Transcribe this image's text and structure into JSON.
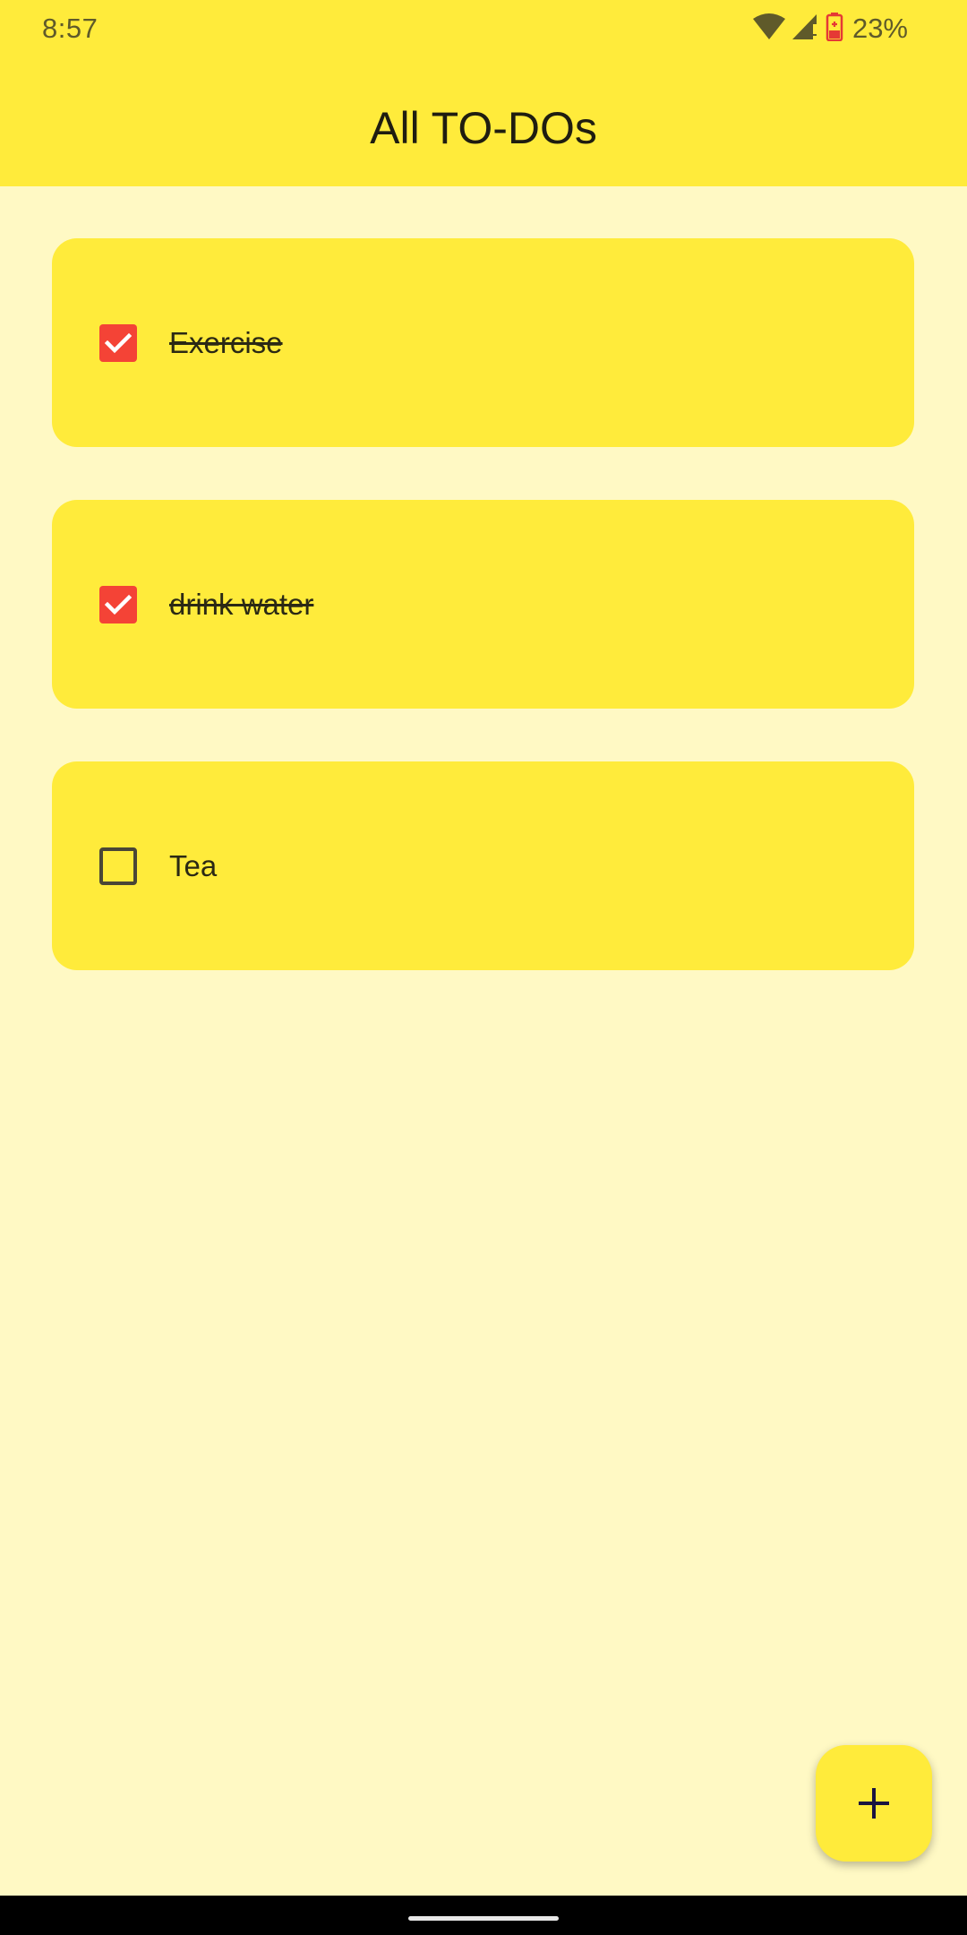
{
  "status_bar": {
    "time": "8:57",
    "battery": "23%",
    "icons": [
      "wifi-icon",
      "signal-icon",
      "battery-icon"
    ]
  },
  "app_bar": {
    "title": "All TO-DOs"
  },
  "todos": [
    {
      "label": "Exercise",
      "checked": true
    },
    {
      "label": "drink water",
      "checked": true
    },
    {
      "label": "Tea",
      "checked": false
    }
  ],
  "fab": {
    "icon": "plus-icon"
  },
  "colors": {
    "app_bar": "#FFEB3B",
    "background": "#FFF9C4",
    "card": "#FFEB3B",
    "checkbox_checked": "#F44336"
  }
}
